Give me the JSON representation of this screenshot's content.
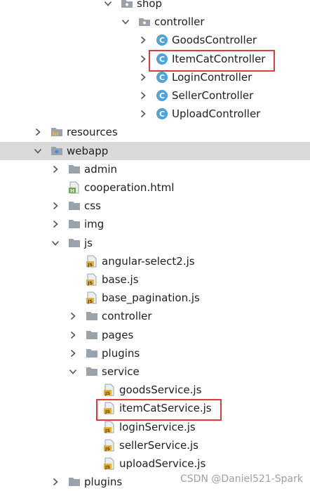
{
  "tree": {
    "items": [
      {
        "label": "shop",
        "kind": "package",
        "arrow": "down",
        "level": 6
      },
      {
        "label": "controller",
        "kind": "package",
        "arrow": "down",
        "level": 7
      },
      {
        "label": "GoodsController",
        "kind": "class",
        "arrow": "right",
        "level": 8
      },
      {
        "label": "ItemCatController",
        "kind": "class",
        "arrow": "right",
        "level": 8,
        "highlighted": true
      },
      {
        "label": "LoginController",
        "kind": "class",
        "arrow": "right",
        "level": 8
      },
      {
        "label": "SellerController",
        "kind": "class",
        "arrow": "right",
        "level": 8
      },
      {
        "label": "UploadController",
        "kind": "class",
        "arrow": "right",
        "level": 8
      },
      {
        "label": "resources",
        "kind": "resources",
        "arrow": "right",
        "level": 2
      },
      {
        "label": "webapp",
        "kind": "webapp",
        "arrow": "down",
        "level": 2,
        "selected": true
      },
      {
        "label": "admin",
        "kind": "folder",
        "arrow": "right",
        "level": 3
      },
      {
        "label": "cooperation.html",
        "kind": "html",
        "arrow": "none",
        "level": 3
      },
      {
        "label": "css",
        "kind": "folder",
        "arrow": "right",
        "level": 3
      },
      {
        "label": "img",
        "kind": "folder",
        "arrow": "right",
        "level": 3
      },
      {
        "label": "js",
        "kind": "folder",
        "arrow": "down",
        "level": 3
      },
      {
        "label": "angular-select2.js",
        "kind": "js",
        "arrow": "none",
        "level": 4
      },
      {
        "label": "base.js",
        "kind": "js",
        "arrow": "none",
        "level": 4
      },
      {
        "label": "base_pagination.js",
        "kind": "js",
        "arrow": "none",
        "level": 4
      },
      {
        "label": "controller",
        "kind": "folder",
        "arrow": "right",
        "level": 4
      },
      {
        "label": "pages",
        "kind": "folder",
        "arrow": "right",
        "level": 4
      },
      {
        "label": "plugins",
        "kind": "folder",
        "arrow": "right",
        "level": 4
      },
      {
        "label": "service",
        "kind": "folder",
        "arrow": "down",
        "level": 4
      },
      {
        "label": "goodsService.js",
        "kind": "js",
        "arrow": "none",
        "level": 5
      },
      {
        "label": "itemCatService.js",
        "kind": "js",
        "arrow": "none",
        "level": 5,
        "highlighted": true
      },
      {
        "label": "loginService.js",
        "kind": "js",
        "arrow": "none",
        "level": 5
      },
      {
        "label": "sellerService.js",
        "kind": "js",
        "arrow": "none",
        "level": 5
      },
      {
        "label": "uploadService.js",
        "kind": "js",
        "arrow": "none",
        "level": 5
      },
      {
        "label": "plugins",
        "kind": "folder",
        "arrow": "right",
        "level": 3
      }
    ]
  },
  "watermark": "CSDN @Daniel521-Spark",
  "colors": {
    "selection": "#dadada",
    "highlight_border": "#e03a3a",
    "class_icon": "#4ea3d8",
    "folder": "#9aa3ad",
    "js_badge": "#e3b341"
  }
}
